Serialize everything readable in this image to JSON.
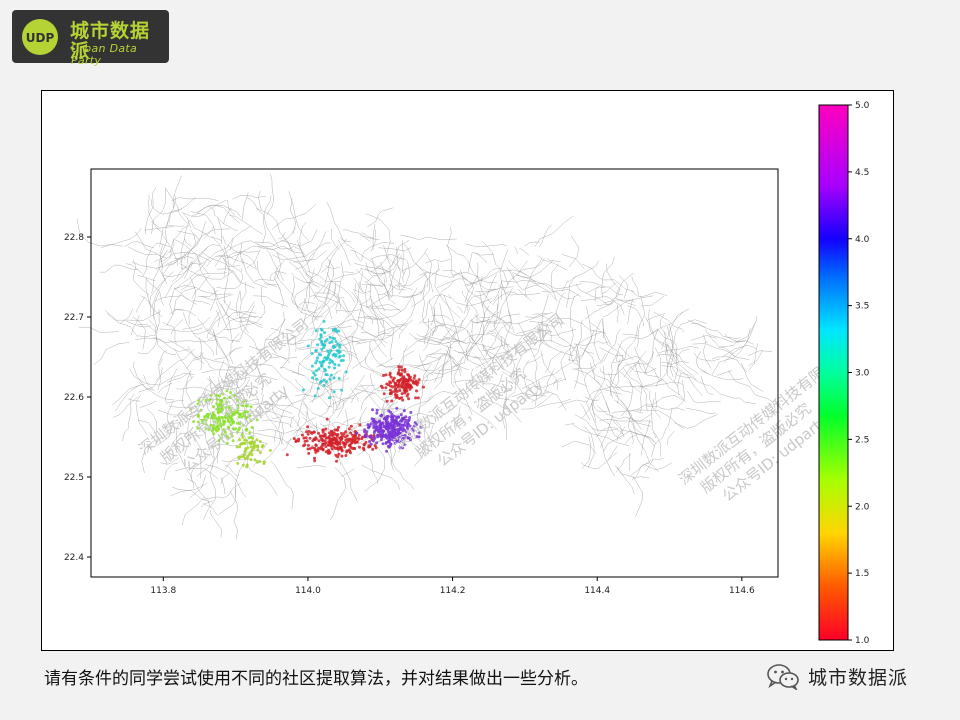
{
  "logo": {
    "mark": "UDP",
    "title": "城市数据派",
    "subtitle": "Urban Data Party"
  },
  "caption": "请有条件的同学尝试使用不同的社区提取算法，并对结果做出一些分析。",
  "footer": {
    "icon": "wechat-icon",
    "brand": "城市数据派"
  },
  "watermarks": [
    [
      "深圳数派互动传媒科技有限公司",
      "版权所有，盗版必究",
      "公众号ID: udparty"
    ],
    [
      "深圳数派互动传媒科技有限公司",
      "版权所有，盗版必究",
      "公众号ID: udparty"
    ],
    [
      "深圳数派互动传媒科技有限公司",
      "版权所有，盗版必究",
      "公众号ID: udparty"
    ]
  ],
  "colors": {
    "accent": "#b5d334",
    "logo_bg": "#333333",
    "road": "#8a8a8a"
  },
  "chart_data": {
    "type": "scatter",
    "title": "",
    "xlabel": "",
    "ylabel": "",
    "xlim": [
      113.7,
      114.65
    ],
    "ylim": [
      22.375,
      22.885
    ],
    "xticks": [
      113.8,
      114.0,
      114.2,
      114.4,
      114.6
    ],
    "yticks": [
      22.4,
      22.5,
      22.6,
      22.7,
      22.8
    ],
    "xtick_labels": [
      "113.8",
      "114.0",
      "114.2",
      "114.4",
      "114.6"
    ],
    "ytick_labels": [
      "22.4",
      "22.5",
      "22.6",
      "22.7",
      "22.8"
    ],
    "background": "Shenzhen road network (gray lines)",
    "colorbar": {
      "colormap": "gist_rainbow_r",
      "min": 1.0,
      "max": 5.0,
      "ticks": [
        1.0,
        1.5,
        2.0,
        2.5,
        3.0,
        3.5,
        4.0,
        4.5,
        5.0
      ],
      "tick_labels": [
        "1.0",
        "1.5",
        "2.0",
        "2.5",
        "3.0",
        "3.5",
        "4.0",
        "4.5",
        "5.0"
      ]
    },
    "clusters": [
      {
        "value": 2.0,
        "color": "#8ae02a",
        "center": [
          113.885,
          22.575
        ],
        "spread": [
          0.035,
          0.025
        ],
        "count": 170
      },
      {
        "value": 1.8,
        "color": "#a6d42a",
        "center": [
          113.92,
          22.535
        ],
        "spread": [
          0.02,
          0.018
        ],
        "count": 60
      },
      {
        "value": 2.9,
        "color": "#27c9cf",
        "center": [
          114.025,
          22.65
        ],
        "spread": [
          0.022,
          0.035
        ],
        "count": 110
      },
      {
        "value": 1.0,
        "color": "#d42028",
        "center": [
          114.13,
          22.615
        ],
        "spread": [
          0.022,
          0.015
        ],
        "count": 130
      },
      {
        "value": 1.0,
        "color": "#d42028",
        "center": [
          114.04,
          22.545
        ],
        "spread": [
          0.045,
          0.018
        ],
        "count": 230
      },
      {
        "value": 3.8,
        "color": "#7a33d6",
        "center": [
          114.115,
          22.56
        ],
        "spread": [
          0.03,
          0.02
        ],
        "count": 280
      }
    ]
  }
}
